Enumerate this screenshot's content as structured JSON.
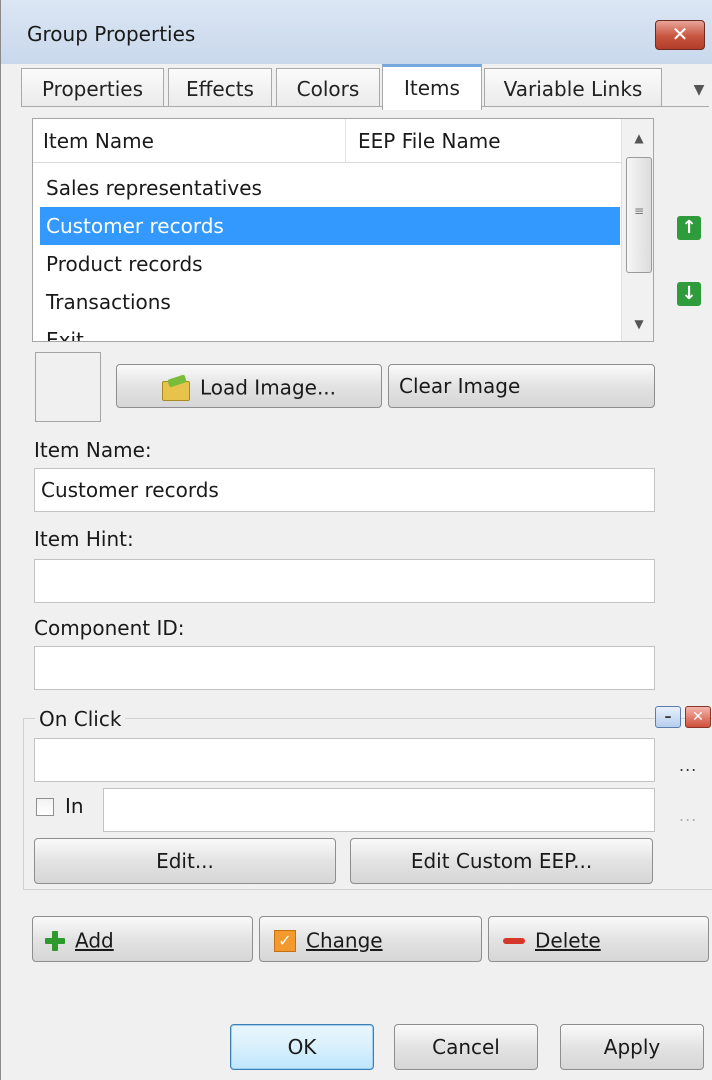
{
  "window": {
    "title": "Group Properties",
    "close_label": "✕"
  },
  "tabs": [
    {
      "label": "Properties"
    },
    {
      "label": "Effects"
    },
    {
      "label": "Colors"
    },
    {
      "label": "Items"
    },
    {
      "label": "Variable Links"
    }
  ],
  "active_tab": "Items",
  "items_list": {
    "columns": [
      "Item Name",
      "EEP File Name"
    ],
    "rows": [
      {
        "name": "Sales representatives",
        "eep": ""
      },
      {
        "name": "Customer records",
        "eep": ""
      },
      {
        "name": "Product records",
        "eep": ""
      },
      {
        "name": "Transactions",
        "eep": ""
      },
      {
        "name": "Exit",
        "eep": ""
      }
    ],
    "selected_row": "Customer records"
  },
  "image": {
    "load_label": "Load Image...",
    "clear_label": "Clear Image"
  },
  "form": {
    "item_name_label": "Item Name:",
    "item_name_value": "Customer records",
    "item_hint_label": "Item Hint:",
    "item_hint_value": "",
    "component_id_label": "Component ID:",
    "component_id_value": ""
  },
  "on_click": {
    "title": "On Click",
    "action_value": "",
    "in_label": "In",
    "in_checked": false,
    "in_value": "",
    "ellipsis": "...",
    "edit_label": "Edit...",
    "edit_custom_label": "Edit Custom EEP..."
  },
  "actions": {
    "add_label": "Add",
    "change_label": "Change",
    "delete_label": "Delete"
  },
  "footer": {
    "ok_label": "OK",
    "cancel_label": "Cancel",
    "apply_label": "Apply"
  },
  "colors": {
    "selection": "#3399ff",
    "accent_tab": "#78a8e0",
    "arrow_green": "#2f9c3b",
    "close_red": "#c8553f"
  }
}
